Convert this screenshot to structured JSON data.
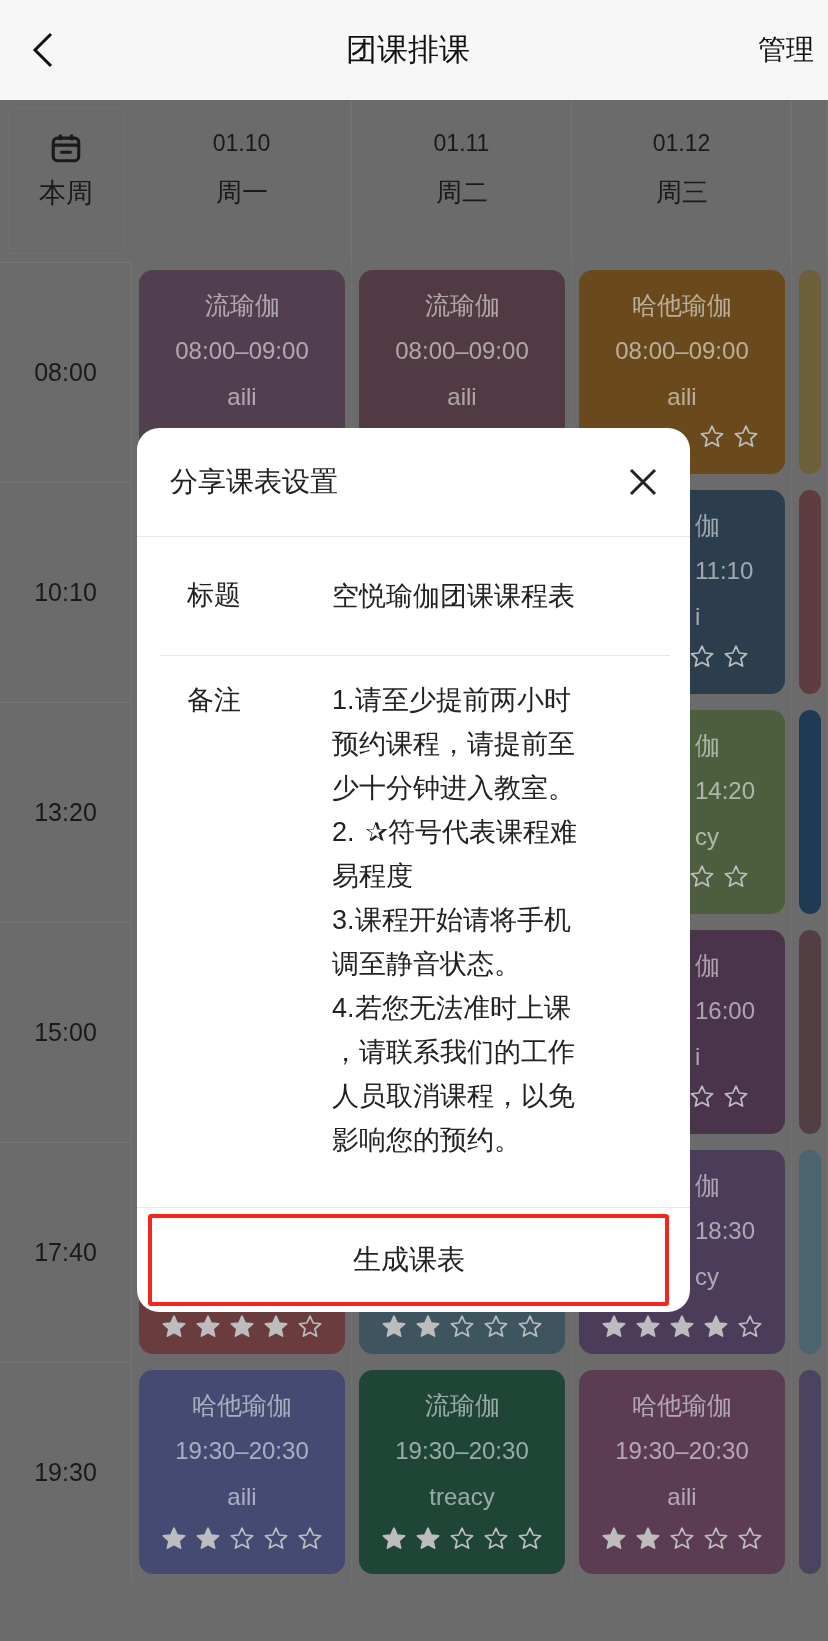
{
  "header": {
    "title": "团课排课",
    "action": "管理"
  },
  "week_label": "本周",
  "days": [
    {
      "date": "01.10",
      "weekday": "周一"
    },
    {
      "date": "01.11",
      "weekday": "周二"
    },
    {
      "date": "01.12",
      "weekday": "周三"
    }
  ],
  "rows": [
    {
      "time": "08:00",
      "cards": [
        {
          "kind": "upper",
          "color": "#513f50",
          "title": "流瑜伽",
          "time": "08:00–09:00",
          "teacher": "aili"
        },
        {
          "kind": "upper",
          "color": "#513a43",
          "title": "流瑜伽",
          "time": "08:00–09:00",
          "teacher": "aili"
        },
        {
          "kind": "upper_stars",
          "color": "#6a4a1c",
          "title": "哈他瑜伽",
          "time": "08:00–09:00",
          "teacher": "aili"
        },
        {
          "kind": "edge",
          "color": "#6d5f3a"
        }
      ]
    },
    {
      "time": "10:10",
      "cards": [
        {
          "kind": "hidden"
        },
        {
          "kind": "hidden"
        },
        {
          "kind": "right",
          "color": "#2c3e4e",
          "title": "伽",
          "time": "11:10",
          "teacher": "i"
        },
        {
          "kind": "edge",
          "color": "#5e3c40"
        }
      ]
    },
    {
      "time": "13:20",
      "cards": [
        {
          "kind": "hidden"
        },
        {
          "kind": "hidden"
        },
        {
          "kind": "right",
          "color": "#4d5e3e",
          "title": "伽",
          "time": "14:20",
          "teacher": "cy"
        },
        {
          "kind": "edge",
          "color": "#1f3a55"
        }
      ]
    },
    {
      "time": "15:00",
      "cards": [
        {
          "kind": "hidden"
        },
        {
          "kind": "hidden"
        },
        {
          "kind": "right",
          "color": "#4a344c",
          "title": "伽",
          "time": "16:00",
          "teacher": "i"
        },
        {
          "kind": "edge",
          "color": "#533e44"
        }
      ]
    },
    {
      "time": "17:40",
      "cards": [
        {
          "kind": "lower",
          "color": "#6a3c3e",
          "stars": 4
        },
        {
          "kind": "lower",
          "color": "#3e5560",
          "stars": 2
        },
        {
          "kind": "right_lower",
          "color": "#4b3d5a",
          "title": "伽",
          "time": "18:30",
          "teacher": "cy",
          "stars": 4
        },
        {
          "kind": "edge",
          "color": "#4a6470"
        }
      ]
    },
    {
      "time": "19:30",
      "cards": [
        {
          "kind": "full",
          "color": "#454a72",
          "title": "哈他瑜伽",
          "time": "19:30–20:30",
          "teacher": "aili",
          "stars": 2
        },
        {
          "kind": "full",
          "color": "#1e4536",
          "title": "流瑜伽",
          "time": "19:30–20:30",
          "teacher": "treacy",
          "stars": 2
        },
        {
          "kind": "full",
          "color": "#5c3c52",
          "title": "哈他瑜伽",
          "time": "19:30–20:30",
          "teacher": "aili",
          "stars": 2
        },
        {
          "kind": "edge",
          "color": "#4c4360"
        }
      ]
    }
  ],
  "dialog": {
    "title": "分享课表设置",
    "title_field": {
      "label": "标题",
      "value": "空悦瑜伽团课课程表"
    },
    "notes_field": {
      "label": "备注",
      "items": [
        "1.请至少提前两小时预约课程，请提前至少十分钟进入教室。",
        "2. ✰符号代表课程难易程度",
        "3.课程开始请将手机调至静音状态。",
        "4.若您无法准时上课，请联系我们的工作人员取消课程，以免影响您的预约。"
      ]
    },
    "button": "生成课表",
    "highlighted": true
  }
}
